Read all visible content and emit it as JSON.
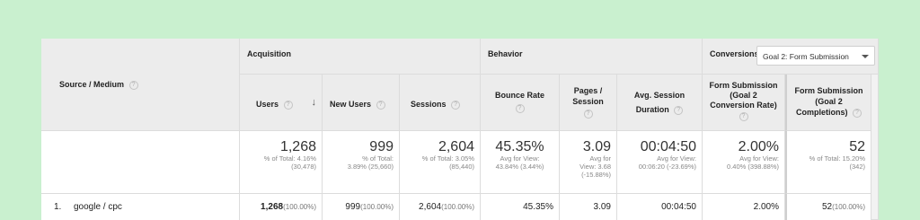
{
  "header": {
    "source_medium": "Source / Medium",
    "acquisition": "Acquisition",
    "behavior": "Behavior",
    "conversions": "Conversions",
    "goal_select": "Goal 2: Form Submission"
  },
  "columns": {
    "users": "Users",
    "new_users": "New Users",
    "sessions": "Sessions",
    "bounce_rate": "Bounce Rate",
    "pages_session_1": "Pages /",
    "pages_session_2": "Session",
    "avg_duration_1": "Avg. Session",
    "avg_duration_2": "Duration",
    "conv_rate_1": "Form Submission",
    "conv_rate_2": "(Goal 2",
    "conv_rate_3": "Conversion Rate)",
    "completions_1": "Form Submission",
    "completions_2": "(Goal 2",
    "completions_3": "Completions)"
  },
  "totals": {
    "users": "1,268",
    "users_sub1": "% of Total: 4.16%",
    "users_sub2": "(30,478)",
    "new_users": "999",
    "new_users_sub1": "% of Total:",
    "new_users_sub2": "3.89% (25,660)",
    "sessions": "2,604",
    "sessions_sub1": "% of Total: 3.05%",
    "sessions_sub2": "(85,440)",
    "bounce_rate": "45.35%",
    "bounce_sub1": "Avg for View:",
    "bounce_sub2": "43.84% (3.44%)",
    "pages": "3.09",
    "pages_sub1": "Avg for",
    "pages_sub2": "View: 3.68",
    "pages_sub3": "(-15.88%)",
    "duration": "00:04:50",
    "duration_sub1": "Avg for View:",
    "duration_sub2": "00:06:20 (-23.69%)",
    "conv_rate": "2.00%",
    "conv_sub1": "Avg for View:",
    "conv_sub2": "0.40% (398.88%)",
    "completions": "52",
    "completions_sub1": "% of Total: 15.20%",
    "completions_sub2": "(342)"
  },
  "rows": [
    {
      "index": "1.",
      "source": "google / cpc",
      "users": "1,268",
      "users_pct": "(100.00%)",
      "new_users": "999",
      "new_users_pct": "(100.00%)",
      "sessions": "2,604",
      "sessions_pct": "(100.00%)",
      "bounce_rate": "45.35%",
      "pages": "3.09",
      "duration": "00:04:50",
      "conv_rate": "2.00%",
      "completions": "52",
      "completions_pct": "(100.00%)"
    }
  ],
  "icons": {
    "help": "?",
    "sort": "↓"
  }
}
